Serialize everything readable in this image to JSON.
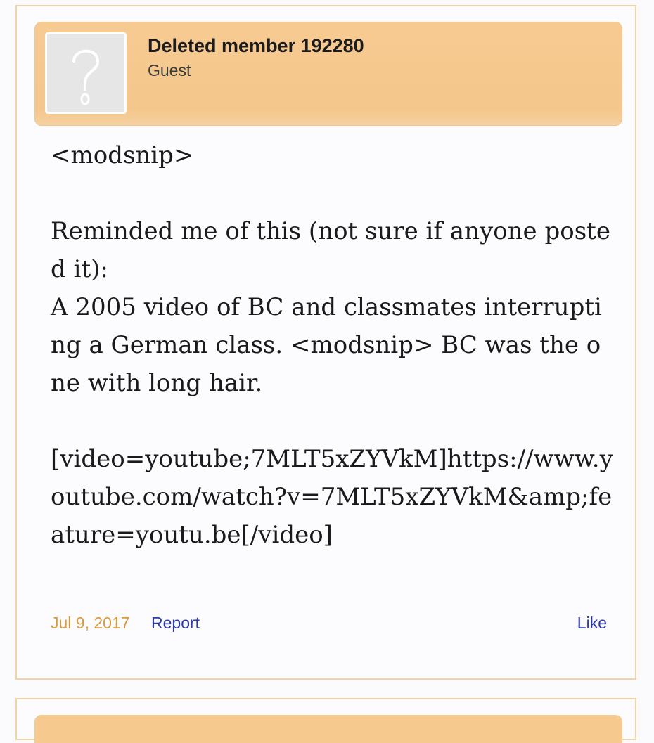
{
  "post": {
    "author": {
      "name": "Deleted member 192280",
      "title": "Guest",
      "avatar_icon": "question-mark-avatar-icon"
    },
    "message": {
      "lines": [
        "<modsnip>",
        "",
        "Reminded me of this (not sure if anyone posted it):",
        "A 2005 video of BC and classmates interrupting a German class. <modsnip> BC was the one with long hair.",
        "",
        "[video=youtube;7MLT5xZYVkM]https://www.youtube.com/watch?v=7MLT5xZYVkM&amp;feature=youtu.be[/video]"
      ]
    },
    "footer": {
      "date": "Jul 9, 2017",
      "report_label": "Report",
      "like_label": "Like"
    }
  },
  "colors": {
    "header_bg": "#f4c78c",
    "border": "#f1d4a6",
    "date": "#d89a3c",
    "link": "#2a3aa6"
  }
}
